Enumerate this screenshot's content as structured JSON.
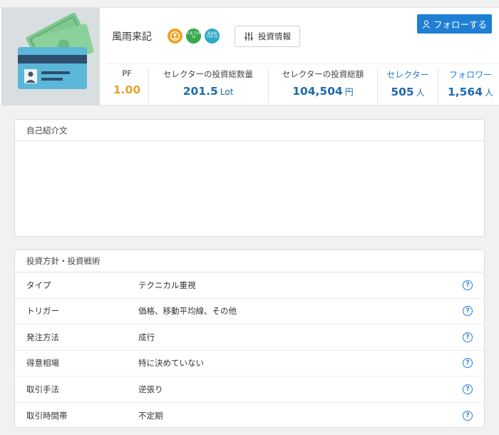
{
  "profile": {
    "name": "風雨来記",
    "badges": {
      "popular": "人気 TOP 10",
      "trusted": "高返益 TOP 10"
    },
    "invest_info_label": "投資情報",
    "follow_label": "フォローする"
  },
  "stats": [
    {
      "label": "PF",
      "value": "1.00",
      "unit": ""
    },
    {
      "label": "セレクターの投資総数量",
      "value": "201.5",
      "unit": "Lot"
    },
    {
      "label": "セレクターの投資総額",
      "value": "104,504",
      "unit": "円"
    },
    {
      "label": "セレクター",
      "value": "505",
      "unit": "人"
    },
    {
      "label": "フォロワー",
      "value": "1,564",
      "unit": "人"
    }
  ],
  "intro": {
    "title": "自己紹介文"
  },
  "strategy": {
    "title": "投資方針・投資戦術",
    "rows": [
      {
        "label": "タイプ",
        "value": "テクニカル重視"
      },
      {
        "label": "トリガー",
        "value": "価格、移動平均線、その他"
      },
      {
        "label": "発注方法",
        "value": "成行"
      },
      {
        "label": "得意相場",
        "value": "特に決めていない"
      },
      {
        "label": "取引手法",
        "value": "逆張り"
      },
      {
        "label": "取引時間帯",
        "value": "不定期"
      }
    ],
    "help_glyph": "?"
  },
  "colors": {
    "accent": "#1f7fd4",
    "value_blue": "#1f6ab0",
    "pf_gold": "#e0a42a"
  }
}
